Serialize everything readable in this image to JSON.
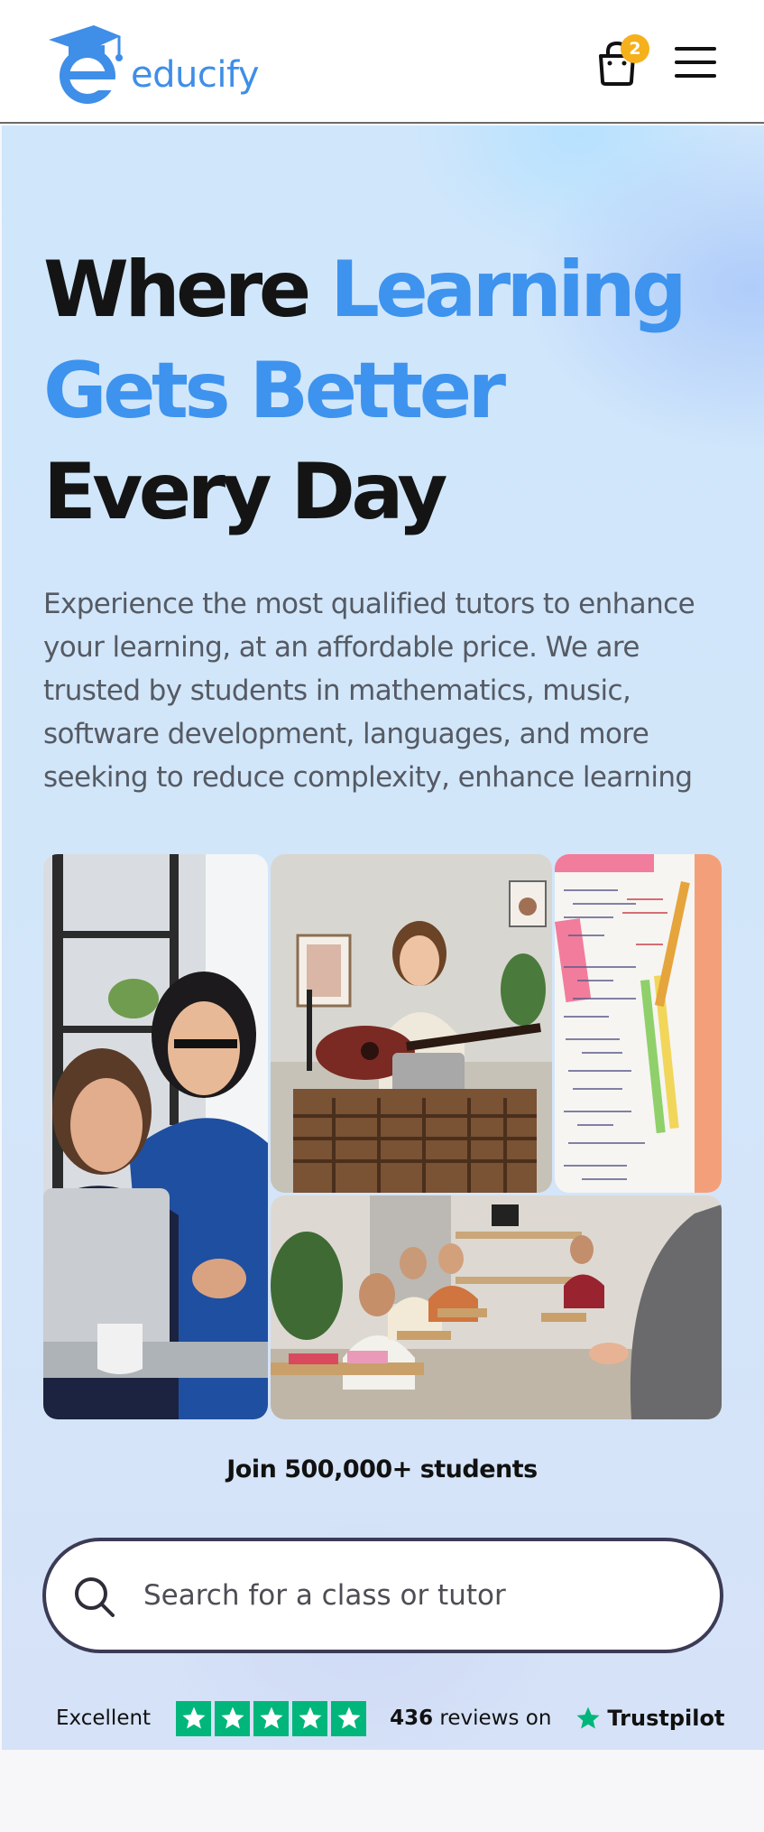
{
  "header": {
    "logo_text": "educify",
    "cart_count": "2",
    "icons": {
      "logo": "graduation-cap-logo",
      "cart": "shopping-bag-icon",
      "menu": "hamburger-menu-icon"
    }
  },
  "hero": {
    "headline": {
      "line1_dark": "Where ",
      "line1_blue": "Learning",
      "line2_blue": "Gets Better",
      "line3_dark": "Every Day"
    },
    "subtext": "Experience the most qualified tutors to enhance your learning, at an affordable price. We are trusted by students in mathematics, music, software development, languages, and more seeking to reduce complexity, enhance learning",
    "photos": [
      {
        "name": "tutors-at-laptop-photo"
      },
      {
        "name": "guitar-student-photo"
      },
      {
        "name": "math-notes-photo"
      },
      {
        "name": "classroom-students-photo"
      }
    ],
    "join_text": "Join 500,000+ students",
    "search": {
      "placeholder": "Search for a class or tutor",
      "value": ""
    },
    "trust": {
      "rating_word": "Excellent",
      "stars": 5,
      "review_count": "436",
      "reviews_suffix": " reviews on",
      "brand": "Trustpilot"
    }
  },
  "colors": {
    "accent_blue": "#3d93ee",
    "badge_yellow": "#f5b01c",
    "trustpilot_green": "#00b67a",
    "text_dark": "#141414"
  }
}
